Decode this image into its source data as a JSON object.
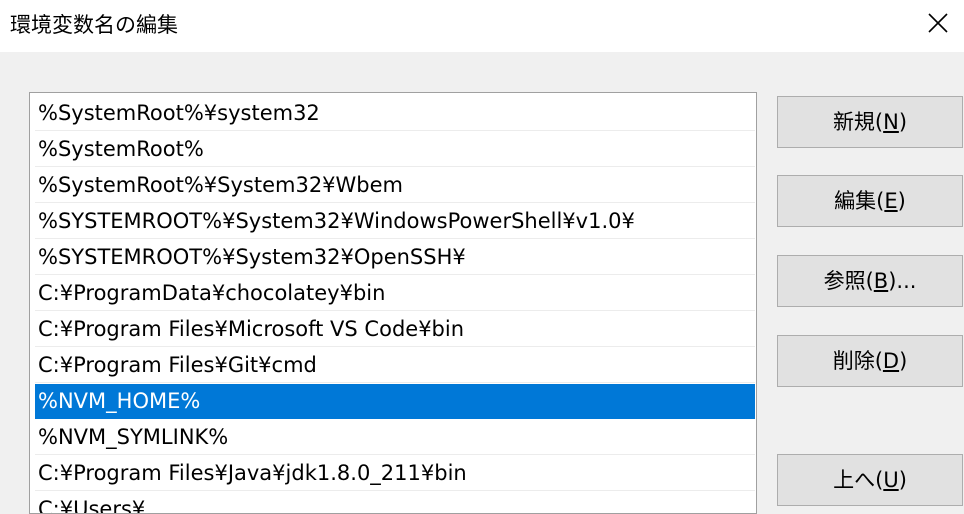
{
  "window": {
    "title": "環境変数名の編集",
    "close_icon": "close-icon"
  },
  "list": {
    "items": [
      "%SystemRoot%¥system32",
      "%SystemRoot%",
      "%SystemRoot%¥System32¥Wbem",
      "%SYSTEMROOT%¥System32¥WindowsPowerShell¥v1.0¥",
      "%SYSTEMROOT%¥System32¥OpenSSH¥",
      "C:¥ProgramData¥chocolatey¥bin",
      "C:¥Program Files¥Microsoft VS Code¥bin",
      "C:¥Program Files¥Git¥cmd",
      "%NVM_HOME%",
      "%NVM_SYMLINK%",
      "C:¥Program Files¥Java¥jdk1.8.0_211¥bin",
      "C:¥Users¥..."
    ],
    "selected_index": 8,
    "selected_color": "#0078d7"
  },
  "buttons": {
    "new": {
      "pre": "新規(",
      "key": "N",
      "post": ")"
    },
    "edit": {
      "pre": "編集(",
      "key": "E",
      "post": ")"
    },
    "browse": {
      "pre": "参照(",
      "key": "B",
      "post": ")..."
    },
    "delete": {
      "pre": "削除(",
      "key": "D",
      "post": ")"
    },
    "move_up": {
      "pre": "上へ(",
      "key": "U",
      "post": ")"
    }
  }
}
